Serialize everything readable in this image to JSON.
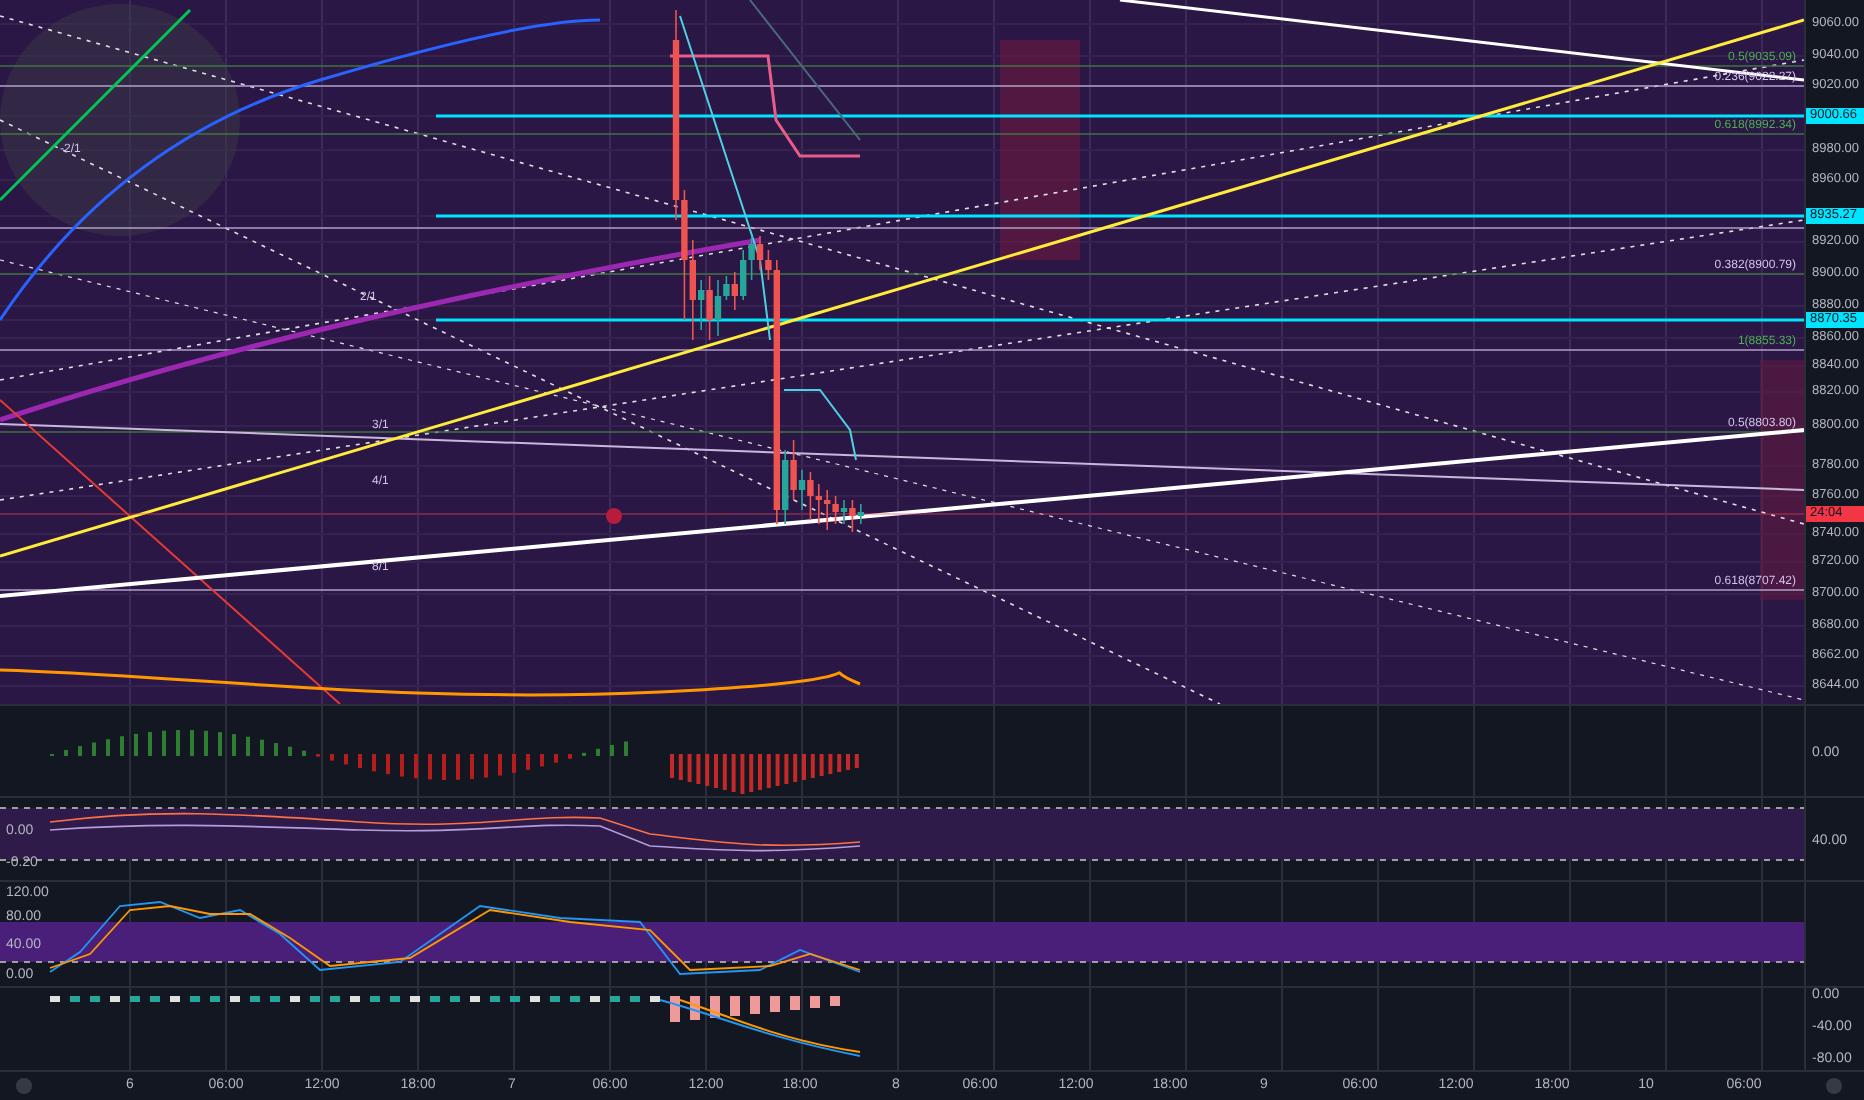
{
  "price_axis": [
    {
      "label": "9060.00",
      "kind": "tick"
    },
    {
      "label": "9040.00",
      "kind": "tick"
    },
    {
      "label": "9020.00",
      "kind": "tick"
    },
    {
      "label": "9000.66",
      "kind": "marker",
      "color": "#00e5ff"
    },
    {
      "label": "8980.00",
      "kind": "tick"
    },
    {
      "label": "8960.00",
      "kind": "tick"
    },
    {
      "label": "8935.27",
      "kind": "marker",
      "color": "#00e5ff"
    },
    {
      "label": "8920.00",
      "kind": "tick"
    },
    {
      "label": "8900.00",
      "kind": "tick"
    },
    {
      "label": "8880.00",
      "kind": "tick"
    },
    {
      "label": "8870.35",
      "kind": "marker",
      "color": "#00e5ff"
    },
    {
      "label": "8860.00",
      "kind": "tick"
    },
    {
      "label": "8840.00",
      "kind": "tick"
    },
    {
      "label": "8820.00",
      "kind": "tick"
    },
    {
      "label": "8800.00",
      "kind": "tick"
    },
    {
      "label": "8780.00",
      "kind": "tick"
    },
    {
      "label": "8760.00",
      "kind": "tick"
    },
    {
      "label": "24:04",
      "kind": "marker",
      "color": "#f23645"
    },
    {
      "label": "8740.00",
      "kind": "tick"
    },
    {
      "label": "8720.00",
      "kind": "tick"
    },
    {
      "label": "8700.00",
      "kind": "tick"
    },
    {
      "label": "8680.00",
      "kind": "tick"
    },
    {
      "label": "8662.00",
      "kind": "tick"
    },
    {
      "label": "8644.00",
      "kind": "tick"
    }
  ],
  "fib_levels": [
    {
      "label": "0.5(9035.09)",
      "color": "#4caf50"
    },
    {
      "label": "0.236(9022.27)",
      "color": "#d1c4e9"
    },
    {
      "label": "0.618(8992.34)",
      "color": "#4caf50"
    },
    {
      "label": "0.382(8900.79)",
      "color": "#d1c4e9"
    },
    {
      "label": "1(8855.33)",
      "color": "#4caf50"
    },
    {
      "label": "0.5(8803.80)",
      "color": "#d1c4e9"
    },
    {
      "label": "0.618(8707.42)",
      "color": "#d1c4e9"
    }
  ],
  "fan_labels": [
    "-2/1",
    "2/1",
    "3/1",
    "4/1",
    "8/1"
  ],
  "panes": [
    {
      "right_scale": [
        "0.00"
      ]
    },
    {
      "left_scale": [
        "0.00",
        "-0.20"
      ],
      "right_scale": [
        "40.00"
      ]
    },
    {
      "left_scale": [
        "120.00",
        "80.00",
        "40.00",
        "0.00"
      ]
    },
    {
      "right_scale": [
        "0.00",
        "-40.00",
        "-80.00"
      ]
    }
  ],
  "time_axis": [
    "6",
    "06:00",
    "12:00",
    "18:00",
    "7",
    "06:00",
    "12:00",
    "18:00",
    "8",
    "06:00",
    "12:00",
    "18:00",
    "9",
    "06:00",
    "12:00",
    "18:00",
    "10",
    "06:00"
  ]
}
